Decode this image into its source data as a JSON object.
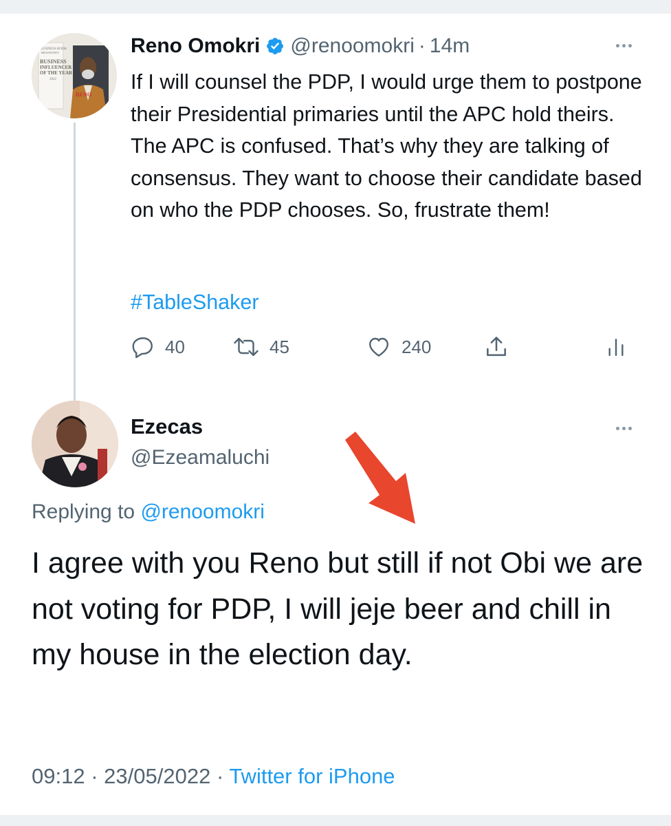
{
  "tweet": {
    "author_name": "Reno Omokri",
    "handle": "@renoomokri",
    "time_sep": "·",
    "time": "14m",
    "text": "If I will counsel the PDP, I would urge them to postpone their Presidential primaries until the APC hold theirs. The APC is confused. That’s why they are talking of consensus. They want to choose their candidate based on who the PDP chooses. So, frustrate them!",
    "hashtag": "#TableShaker",
    "avatar_text": {
      "line1": "BUSINESS BOOK",
      "line2": "BRAND/NEY",
      "line3": "BUSINESS",
      "line4": "INFLUENCER",
      "line5": "OF THE YEAR",
      "line6": "2022",
      "line7": "RENO"
    },
    "stats": {
      "replies": "40",
      "retweets": "45",
      "likes": "240"
    },
    "icons": [
      "verified-badge-icon",
      "more-icon",
      "reply-icon",
      "retweet-icon",
      "like-icon",
      "share-icon",
      "analytics-icon"
    ]
  },
  "reply": {
    "author_name": "Ezecas",
    "handle": "@Ezeamaluchi",
    "replying_prefix": "Replying to",
    "replying_handle": "@renoomokri",
    "text": "I agree with you Reno but still if not Obi we are not voting for PDP, I will jeje beer and chill in my house in the election day.",
    "time": "09:12",
    "sep1": "·",
    "date": "23/05/2022",
    "sep2": "·",
    "source": "Twitter for iPhone"
  },
  "colors": {
    "text": "#0f1419",
    "secondary": "#536471",
    "link": "#1d9bf0",
    "arrow": "#e8462d"
  }
}
